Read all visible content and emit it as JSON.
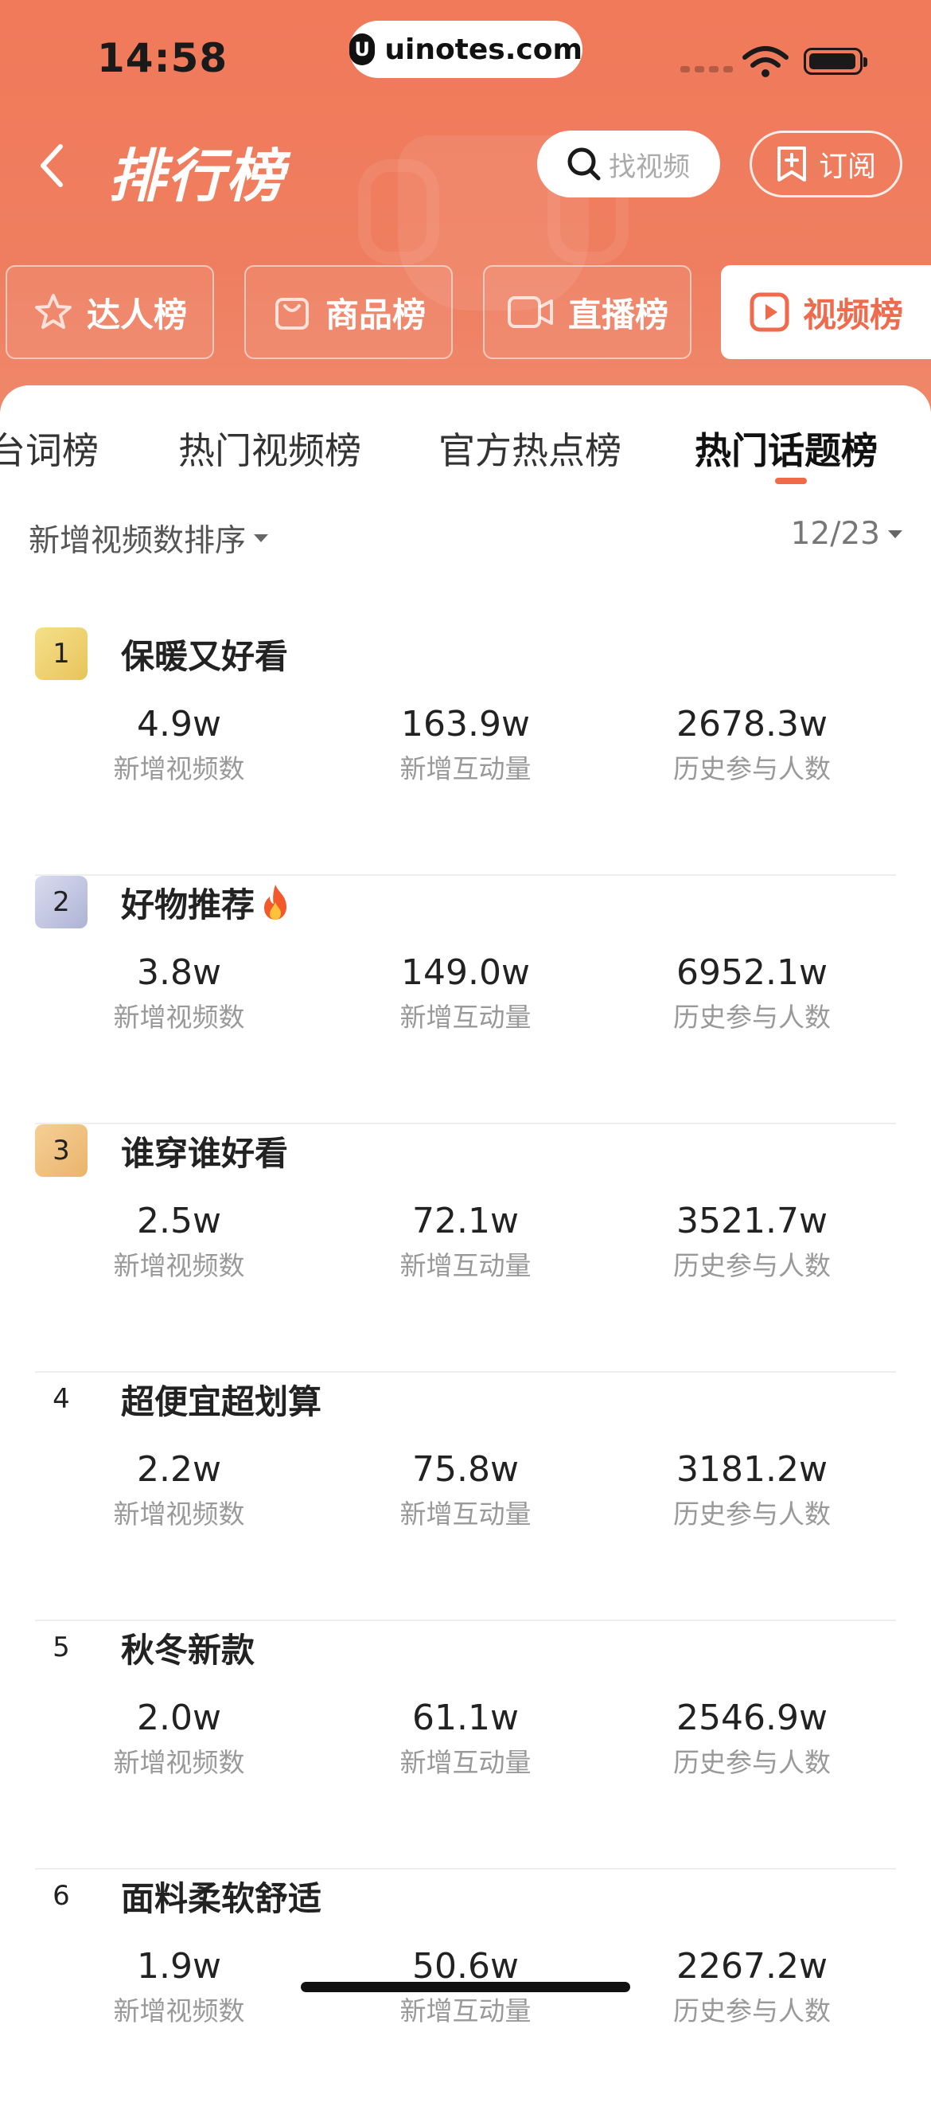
{
  "status": {
    "time": "14:58",
    "site": "uinotes.com"
  },
  "header": {
    "title": "排行榜",
    "search_placeholder": "找视频",
    "subscribe": "订阅"
  },
  "categories": [
    {
      "label": "达人榜",
      "icon": "star-icon"
    },
    {
      "label": "商品榜",
      "icon": "shopping-bag-icon"
    },
    {
      "label": "直播榜",
      "icon": "video-camera-icon"
    },
    {
      "label": "视频榜",
      "icon": "play-icon",
      "active": true
    }
  ],
  "subtabs": [
    "台词榜",
    "热门视频榜",
    "官方热点榜",
    "热门话题榜"
  ],
  "filters": {
    "sort": "新增视频数排序",
    "date": "12/23"
  },
  "stat_labels": {
    "a": "新增视频数",
    "b": "新增互动量",
    "c": "历史参与人数"
  },
  "rows": [
    {
      "rank": "1",
      "topic": "保暖又好看",
      "a": "4.9w",
      "b": "163.9w",
      "c": "2678.3w"
    },
    {
      "rank": "2",
      "topic": "好物推荐",
      "a": "3.8w",
      "b": "149.0w",
      "c": "6952.1w",
      "fire": true
    },
    {
      "rank": "3",
      "topic": "谁穿谁好看",
      "a": "2.5w",
      "b": "72.1w",
      "c": "3521.7w"
    },
    {
      "rank": "4",
      "topic": "超便宜超划算",
      "a": "2.2w",
      "b": "75.8w",
      "c": "3181.2w"
    },
    {
      "rank": "5",
      "topic": "秋冬新款",
      "a": "2.0w",
      "b": "61.1w",
      "c": "2546.9w"
    },
    {
      "rank": "6",
      "topic": "面料柔软舒适",
      "a": "1.9w",
      "b": "50.6w",
      "c": "2267.2w"
    }
  ],
  "colors": {
    "accent": "#ef6b4d",
    "header": "#f07a5a"
  }
}
